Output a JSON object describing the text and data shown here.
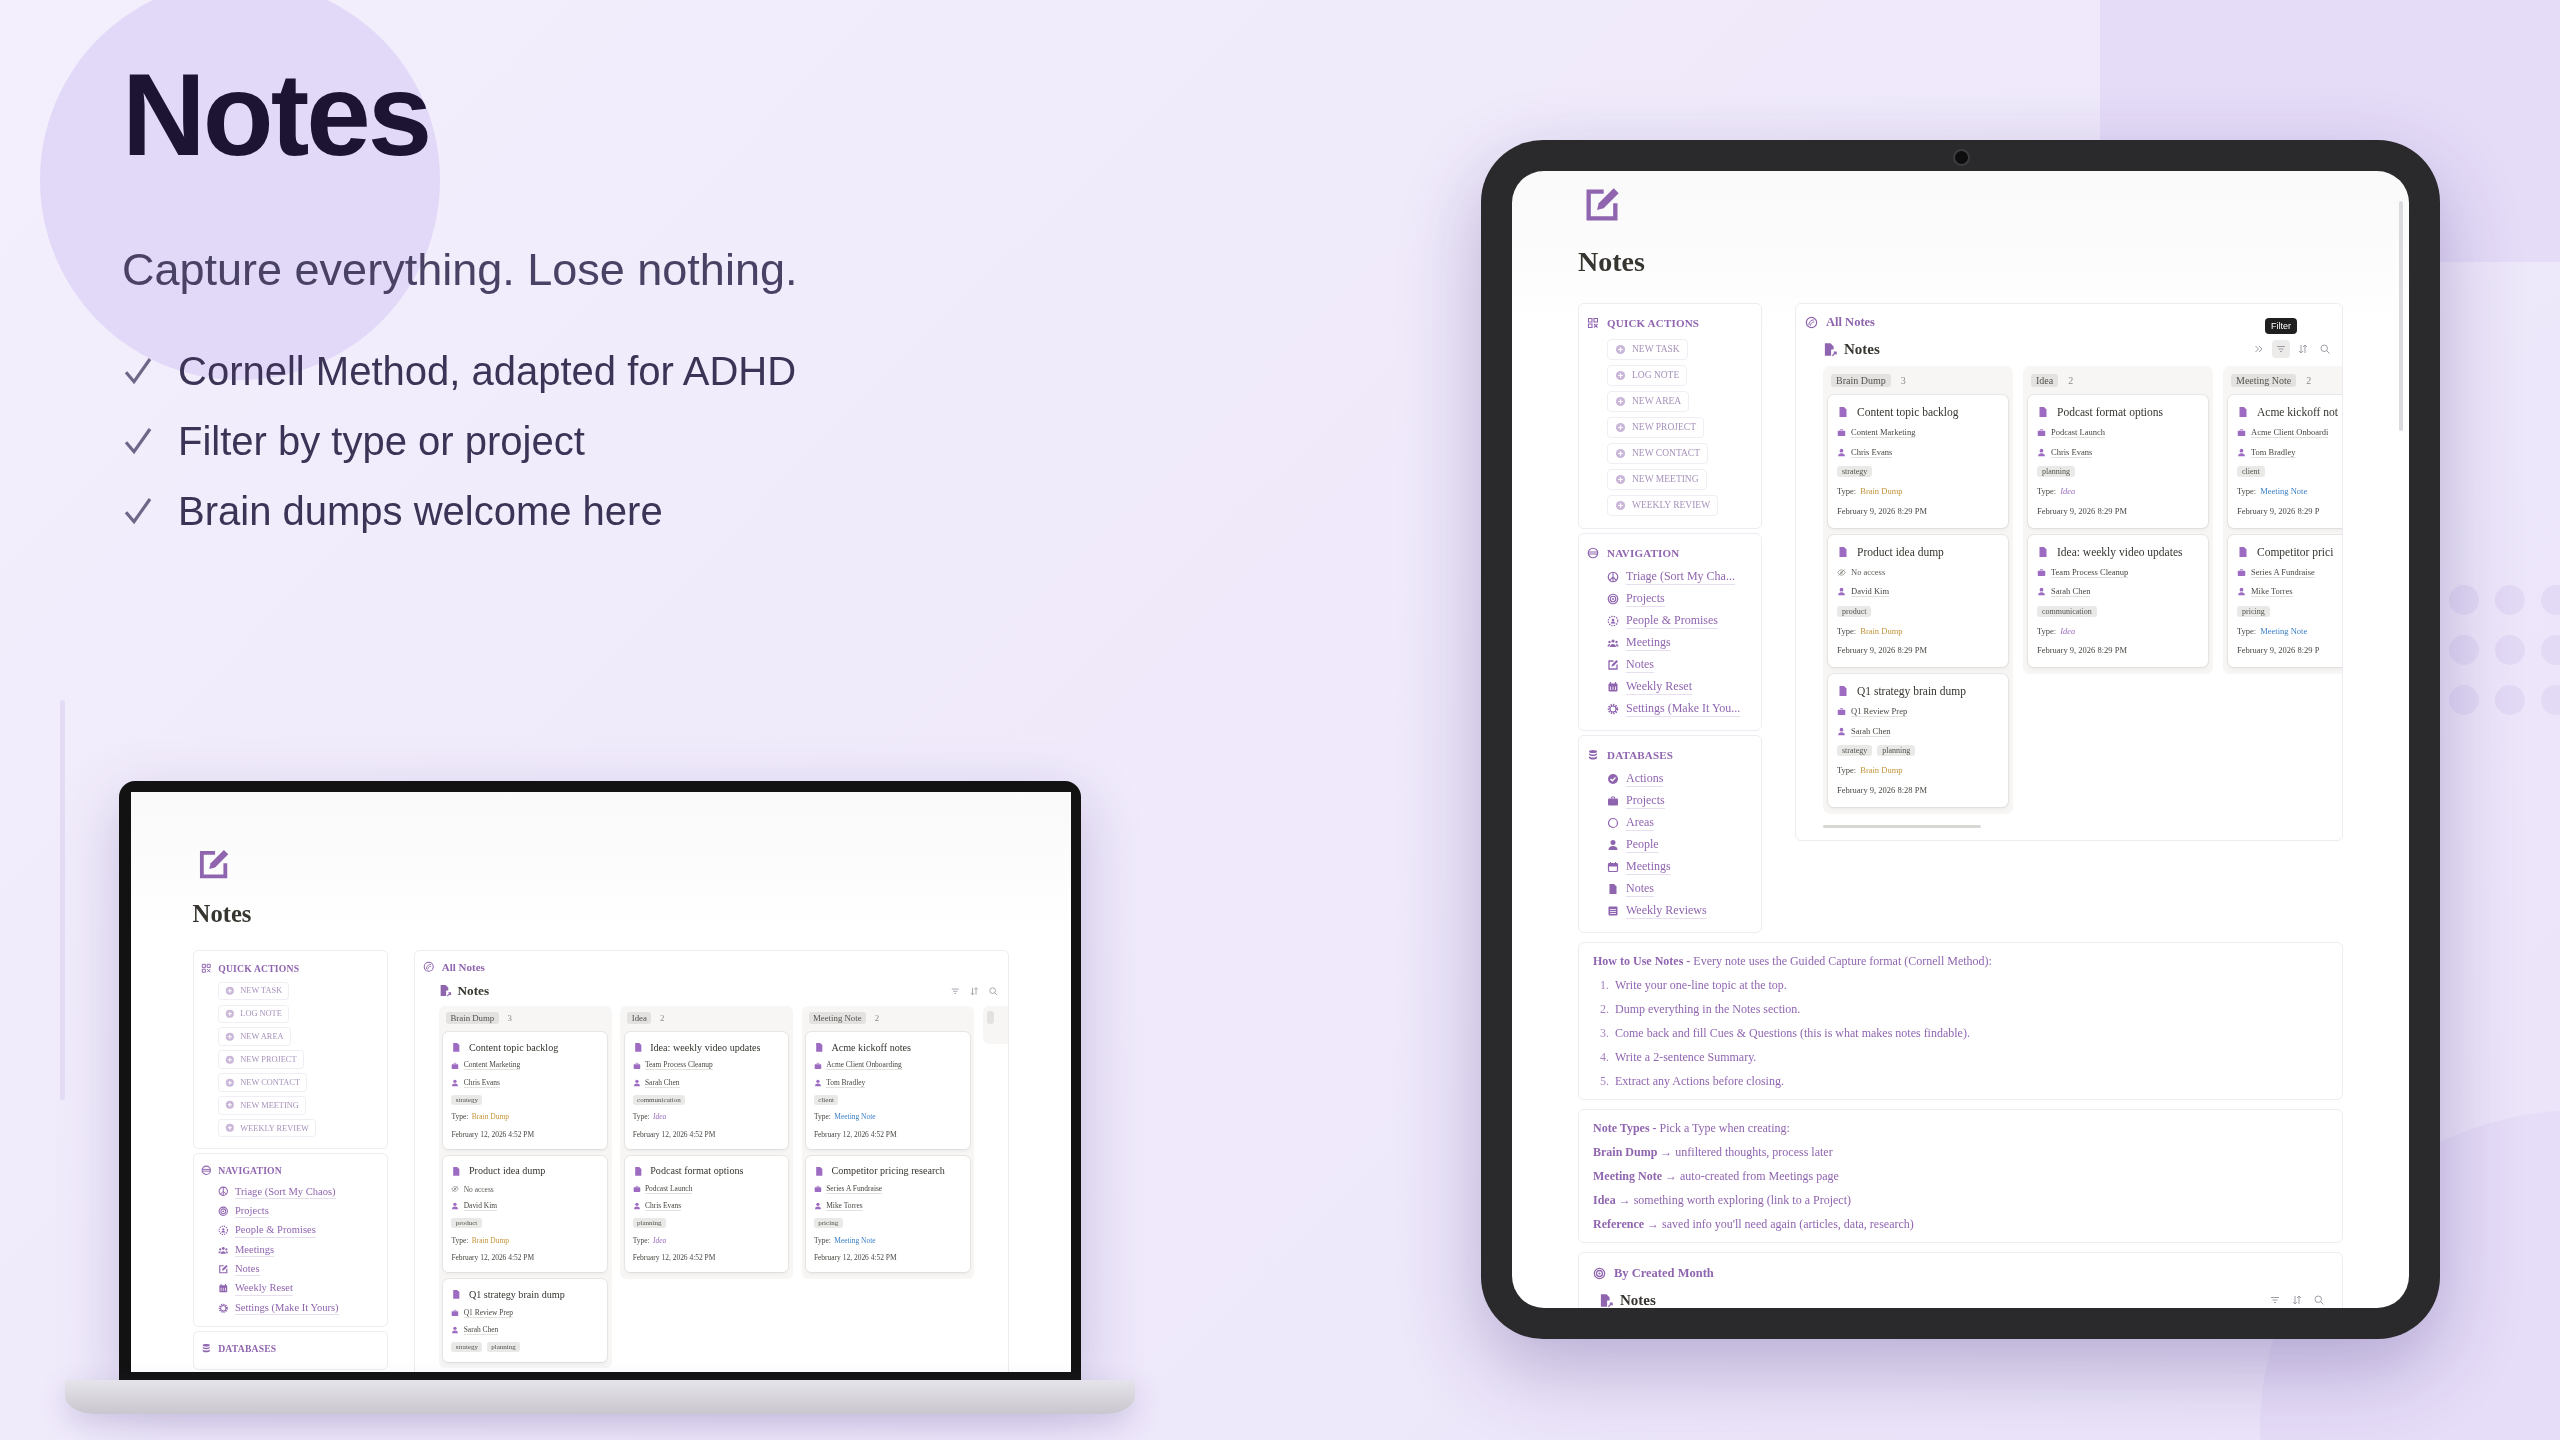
{
  "promo": {
    "title": "Notes",
    "subtitle": "Capture everything. Lose nothing.",
    "features": [
      "Cornell Method, adapted for ADHD",
      "Filter by type or project",
      "Brain dumps welcome here"
    ]
  },
  "laptop": {
    "title": "Notes",
    "quick_actions": {
      "heading": "QUICK ACTIONS",
      "items": [
        "NEW TASK",
        "LOG NOTE",
        "NEW AREA",
        "NEW PROJECT",
        "NEW CONTACT",
        "NEW MEETING",
        "WEEKLY REVIEW"
      ]
    },
    "navigation": {
      "heading": "NAVIGATION",
      "items": [
        "Triage (Sort My Chaos)",
        "Projects",
        "People & Promises",
        "Meetings",
        "Notes",
        "Weekly Reset",
        "Settings (Make It Yours)"
      ]
    },
    "databases": {
      "heading": "DATABASES"
    },
    "board": {
      "heading": "All Notes",
      "view_title": "Notes",
      "tools": [
        {
          "kind": "filter",
          "hovered": false
        },
        {
          "kind": "sort",
          "hovered": false
        },
        {
          "kind": "search",
          "hovered": false
        }
      ],
      "columns": [
        {
          "label": "Brain Dump",
          "count": "3",
          "kind": "brain_dump",
          "cards": [
            {
              "title": "Content topic backlog",
              "project": {
                "kind": "project",
                "text": "Content Marketing"
              },
              "person": "Chris Evans",
              "tags": [
                "strategy"
              ],
              "type_label": "Type:",
              "type": "Brain Dump",
              "date": "February 12, 2026 4:52 PM"
            },
            {
              "title": "Product idea dump",
              "project": {
                "kind": "no_access",
                "text": "No access"
              },
              "person": "David Kim",
              "tags": [
                "product"
              ],
              "type_label": "Type:",
              "type": "Brain Dump",
              "date": "February 12, 2026 4:52 PM"
            },
            {
              "title": "Q1 strategy brain dump",
              "project": {
                "kind": "project",
                "text": "Q1 Review Prep"
              },
              "person": "Sarah Chen",
              "tags": [
                "strategy",
                "planning"
              ]
            }
          ]
        },
        {
          "label": "Idea",
          "count": "2",
          "kind": "idea",
          "cards": [
            {
              "title": "Idea: weekly video updates",
              "project": {
                "kind": "project",
                "text": "Team Process Cleanup"
              },
              "person": "Sarah Chen",
              "tags": [
                "communication"
              ],
              "type_label": "Type:",
              "type": "Idea",
              "date": "February 12, 2026 4:52 PM"
            },
            {
              "title": "Podcast format options",
              "project": {
                "kind": "project",
                "text": "Podcast Launch"
              },
              "person": "Chris Evans",
              "tags": [
                "planning"
              ],
              "type_label": "Type:",
              "type": "Idea",
              "date": "February 12, 2026 4:52 PM"
            }
          ]
        },
        {
          "label": "Meeting Note",
          "count": "2",
          "kind": "meeting_note",
          "cards": [
            {
              "title": "Acme kickoff notes",
              "project": {
                "kind": "project",
                "text": "Acme Client Onboarding"
              },
              "person": "Tom Bradley",
              "tags": [
                "client"
              ],
              "type_label": "Type:",
              "type": "Meeting Note",
              "date": "February 12, 2026 4:52 PM"
            },
            {
              "title": "Competitor pricing research",
              "project": {
                "kind": "project",
                "text": "Series A Fundraise"
              },
              "person": "Mike Torres",
              "tags": [
                "pricing"
              ],
              "type_label": "Type:",
              "type": "Meeting Note",
              "date": "February 12, 2026 4:52 PM"
            }
          ]
        }
      ]
    }
  },
  "tablet": {
    "title": "Notes",
    "quick_actions": {
      "heading": "QUICK ACTIONS",
      "items": [
        "NEW TASK",
        "LOG NOTE",
        "NEW AREA",
        "NEW PROJECT",
        "NEW CONTACT",
        "NEW MEETING",
        "WEEKLY REVIEW"
      ]
    },
    "navigation": {
      "heading": "NAVIGATION",
      "items": [
        "Triage (Sort My Cha...",
        "Projects",
        "People & Promises",
        "Meetings",
        "Notes",
        "Weekly Reset",
        "Settings (Make It You..."
      ]
    },
    "databases": {
      "heading": "DATABASES",
      "items": [
        "Actions",
        "Projects",
        "Areas",
        "People",
        "Meetings",
        "Notes",
        "Weekly Reviews"
      ]
    },
    "board": {
      "heading": "All Notes",
      "view_title": "Notes",
      "tooltip": "Filter",
      "tools": [
        {
          "kind": "expand",
          "hovered": false
        },
        {
          "kind": "filter",
          "hovered": true
        },
        {
          "kind": "sort",
          "hovered": false
        },
        {
          "kind": "search",
          "hovered": false
        }
      ],
      "columns": [
        {
          "label": "Brain Dump",
          "count": "3",
          "kind": "brain_dump",
          "cards": [
            {
              "title": "Content topic backlog",
              "project": {
                "kind": "project",
                "text": "Content Marketing"
              },
              "person": "Chris Evans",
              "tags": [
                "strategy"
              ],
              "type_label": "Type:",
              "type": "Brain Dump",
              "date": "February 9, 2026 8:29 PM"
            },
            {
              "title": "Product idea dump",
              "project": {
                "kind": "no_access",
                "text": "No access"
              },
              "person": "David Kim",
              "tags": [
                "product"
              ],
              "type_label": "Type:",
              "type": "Brain Dump",
              "date": "February 9, 2026 8:29 PM"
            },
            {
              "title": "Q1 strategy brain dump",
              "project": {
                "kind": "project",
                "text": "Q1 Review Prep"
              },
              "person": "Sarah Chen",
              "tags": [
                "strategy",
                "planning"
              ],
              "type_label": "Type:",
              "type": "Brain Dump",
              "date": "February 9, 2026 8:28 PM"
            }
          ]
        },
        {
          "label": "Idea",
          "count": "2",
          "kind": "idea",
          "cards": [
            {
              "title": "Podcast format options",
              "project": {
                "kind": "project",
                "text": "Podcast Launch"
              },
              "person": "Chris Evans",
              "tags": [
                "planning"
              ],
              "type_label": "Type:",
              "type": "Idea",
              "date": "February 9, 2026 8:29 PM"
            },
            {
              "title": "Idea: weekly video updates",
              "project": {
                "kind": "project",
                "text": "Team Process Cleanup"
              },
              "person": "Sarah Chen",
              "tags": [
                "communication"
              ],
              "type_label": "Type:",
              "type": "Idea",
              "date": "February 9, 2026 8:29 PM"
            }
          ]
        },
        {
          "label": "Meeting Note",
          "count": "2",
          "kind": "meeting_note",
          "cards": [
            {
              "title": "Acme kickoff not",
              "project": {
                "kind": "project",
                "text": "Acme Client Onboardi"
              },
              "person": "Tom Bradley",
              "tags": [
                "client"
              ],
              "type_label": "Type:",
              "type": "Meeting Note",
              "date": "February 9, 2026 8:29 P"
            },
            {
              "title": "Competitor prici",
              "project": {
                "kind": "project",
                "text": "Series A Fundraise"
              },
              "person": "Mike Torres",
              "tags": [
                "pricing"
              ],
              "type_label": "Type:",
              "type": "Meeting Note",
              "date": "February 9, 2026 8:29 P"
            }
          ]
        }
      ]
    },
    "how_to": {
      "intro": "**How to Use Notes -** Every note uses the Guided Capture format (Cornell Method):",
      "steps": [
        {
          "number": "1.",
          "text": "Write your one-line topic at the top."
        },
        {
          "number": "2.",
          "text": "Dump everything in the Notes section."
        },
        {
          "number": "3.",
          "text": "Come back and fill Cues & Questions (this is what makes notes findable)."
        },
        {
          "number": "4.",
          "text": "Write a 2-sentence Summary."
        },
        {
          "number": "5.",
          "text": "Extract any Actions before closing."
        }
      ]
    },
    "note_types": [
      "**Note Types -** Pick a Type when creating:",
      "**Brain Dump** → unfiltered thoughts, process later",
      "**Meeting Note** → auto-created from Meetings page",
      "**Idea** → something worth exploring (link to a Project)",
      "**Reference** → saved info you'll need again (articles, data, research)"
    ],
    "by_month": {
      "heading": "By Created Month",
      "view_title": "Notes",
      "tools": [
        {
          "kind": "filter",
          "hovered": false
        },
        {
          "kind": "sort",
          "hovered": false
        },
        {
          "kind": "search",
          "hovered": false
        }
      ]
    }
  }
}
